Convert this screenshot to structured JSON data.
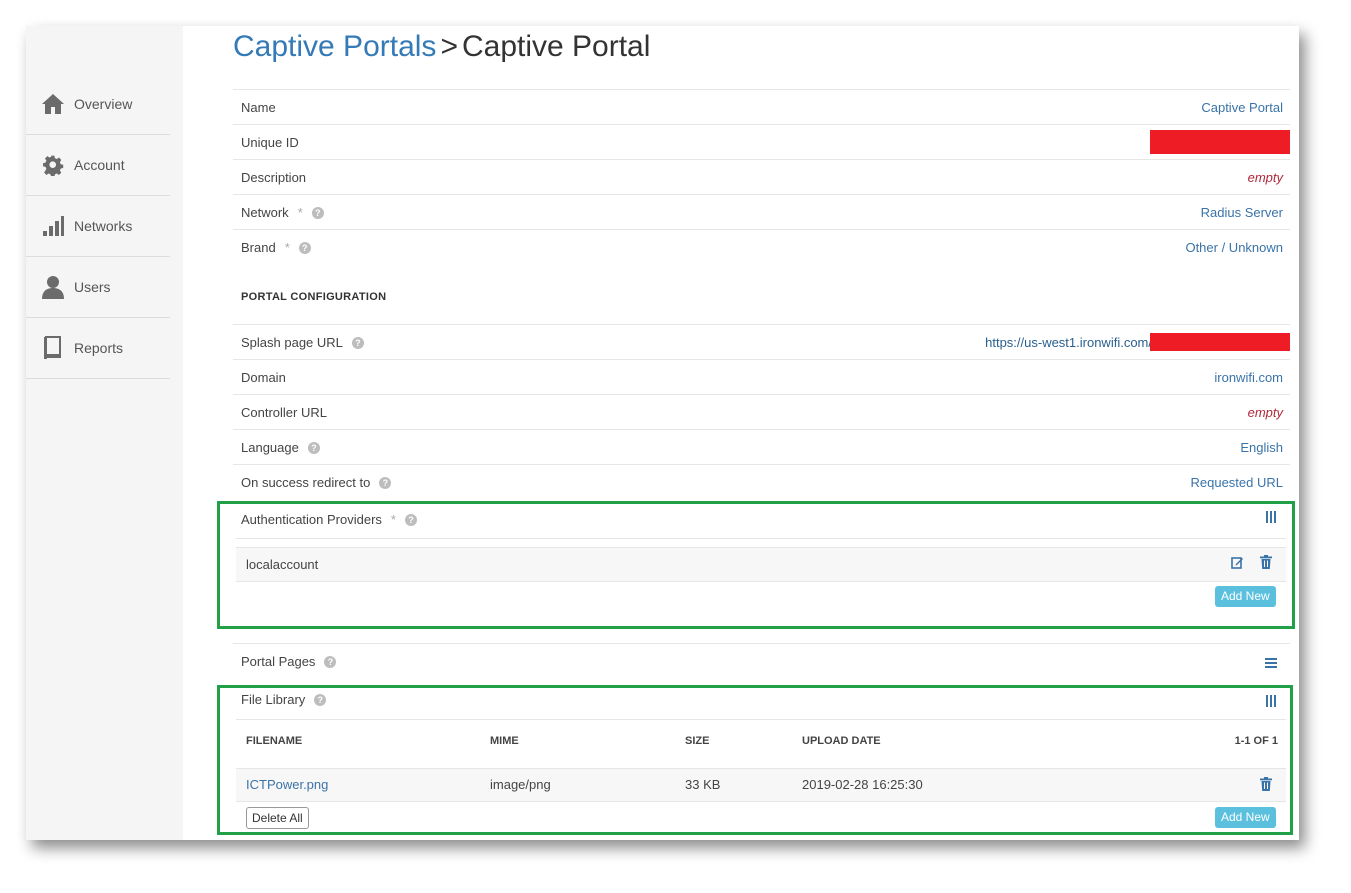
{
  "sidebar": {
    "items": [
      {
        "label": "Overview",
        "icon": "home-icon"
      },
      {
        "label": "Account",
        "icon": "gear-icon"
      },
      {
        "label": "Networks",
        "icon": "signal-bars-icon"
      },
      {
        "label": "Users",
        "icon": "user-icon"
      },
      {
        "label": "Reports",
        "icon": "book-icon"
      }
    ]
  },
  "header": {
    "breadcrumb_parent": "Captive Portals",
    "separator": ">",
    "current": "Captive Portal"
  },
  "fields": [
    {
      "label": "Name",
      "value": "Captive Portal"
    },
    {
      "label": "Unique ID",
      "value": ""
    },
    {
      "label": "Description",
      "value": "empty"
    },
    {
      "label": "Network",
      "required": "*",
      "value": "Radius Server"
    },
    {
      "label": "Brand",
      "required": "*",
      "value": "Other / Unknown"
    }
  ],
  "portal_configuration": {
    "heading": "PORTAL CONFIGURATION",
    "fields": [
      {
        "label": "Splash page URL",
        "value": "https://us-west1.ironwifi.com/"
      },
      {
        "label": "Domain",
        "value": "ironwifi.com"
      },
      {
        "label": "Controller URL",
        "value": "empty"
      },
      {
        "label": "Language",
        "value": "English"
      },
      {
        "label": "On success redirect to",
        "value": "Requested URL"
      }
    ]
  },
  "auth_providers": {
    "label": "Authentication Providers",
    "required": "*",
    "items": [
      {
        "name": "localaccount"
      }
    ],
    "add_label": "Add New"
  },
  "portal_pages": {
    "label": "Portal Pages"
  },
  "file_library": {
    "label": "File Library",
    "columns": [
      "FILENAME",
      "MIME",
      "SIZE",
      "UPLOAD DATE"
    ],
    "pagination": "1-1 OF 1",
    "rows": [
      {
        "filename": "ICTPower.png",
        "mime": "image/png",
        "size": "33 KB",
        "date": "2019-02-28 16:25:30"
      }
    ],
    "delete_all_label": "Delete All",
    "add_label": "Add New"
  },
  "help_glyph": "?",
  "colors": {
    "accent": "#337ab7",
    "link": "#3a73a8",
    "empty": "#b0283c",
    "button": "#5bc0de",
    "highlight": "#21a048",
    "redaction": "#ee1c25"
  }
}
